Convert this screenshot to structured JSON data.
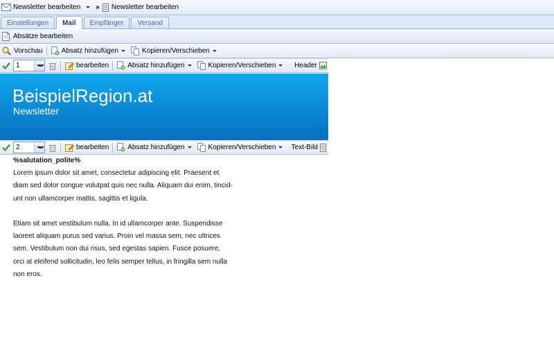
{
  "breadcrumb": {
    "first": "Newsletter bearbeiten",
    "separator": "»",
    "second": "Newsletter bearbeiten"
  },
  "tabs": [
    {
      "label": "Einstellungen",
      "active": false
    },
    {
      "label": "Mail",
      "active": true
    },
    {
      "label": "Empfänger",
      "active": false
    },
    {
      "label": "Versand",
      "active": false
    }
  ],
  "panel": {
    "title": "Absätze bearbeiten"
  },
  "main_toolbar": {
    "preview": "Vorschau",
    "add_paragraph": "Absatz hinzufügen",
    "copy_move": "Kopieren/Verschieben"
  },
  "blocks": [
    {
      "position": "1",
      "edit": "bearbeiten",
      "add_paragraph": "Absatz hinzufügen",
      "copy_move": "Kopieren/Verschieben",
      "type": "Header"
    },
    {
      "position": "2",
      "edit": "bearbeiten",
      "add_paragraph": "Absatz hinzufügen",
      "copy_move": "Kopieren/Verschieben",
      "type": "Text-Bild"
    }
  ],
  "banner": {
    "title": "BeispielRegion.at",
    "subtitle": "Newsletter"
  },
  "content": {
    "salutation": "%salutation_polite%",
    "lines1": [
      "Lorem ipsum dolor sit amet, consectetur adipiscing elit. Praesent et",
      "diam sed dolor congue volutpat quis nec nulla. Aliquam dui enim, tincid-",
      "unt non ullamcorper mattis, sagittis et ligula."
    ],
    "lines2": [
      "Etiam sit amet vestibulum nulla. In id ullamcorper ante. Suspendisse",
      "laoreet aliquam purus sed varius. Proin vel massa sem, nec ultrices",
      "sem. Vestibulum non dui risus, sed egestas sapien. Fusce posuere,",
      "orci at eleifend sollicitudin, leo felis semper tellus, in fringilla sem nulla",
      "non eros."
    ]
  },
  "colors": {
    "banner_top": "#12a8ee",
    "banner_bottom": "#0a6fc0",
    "tab_border": "#8db2e3",
    "accent_text": "#15428b"
  }
}
